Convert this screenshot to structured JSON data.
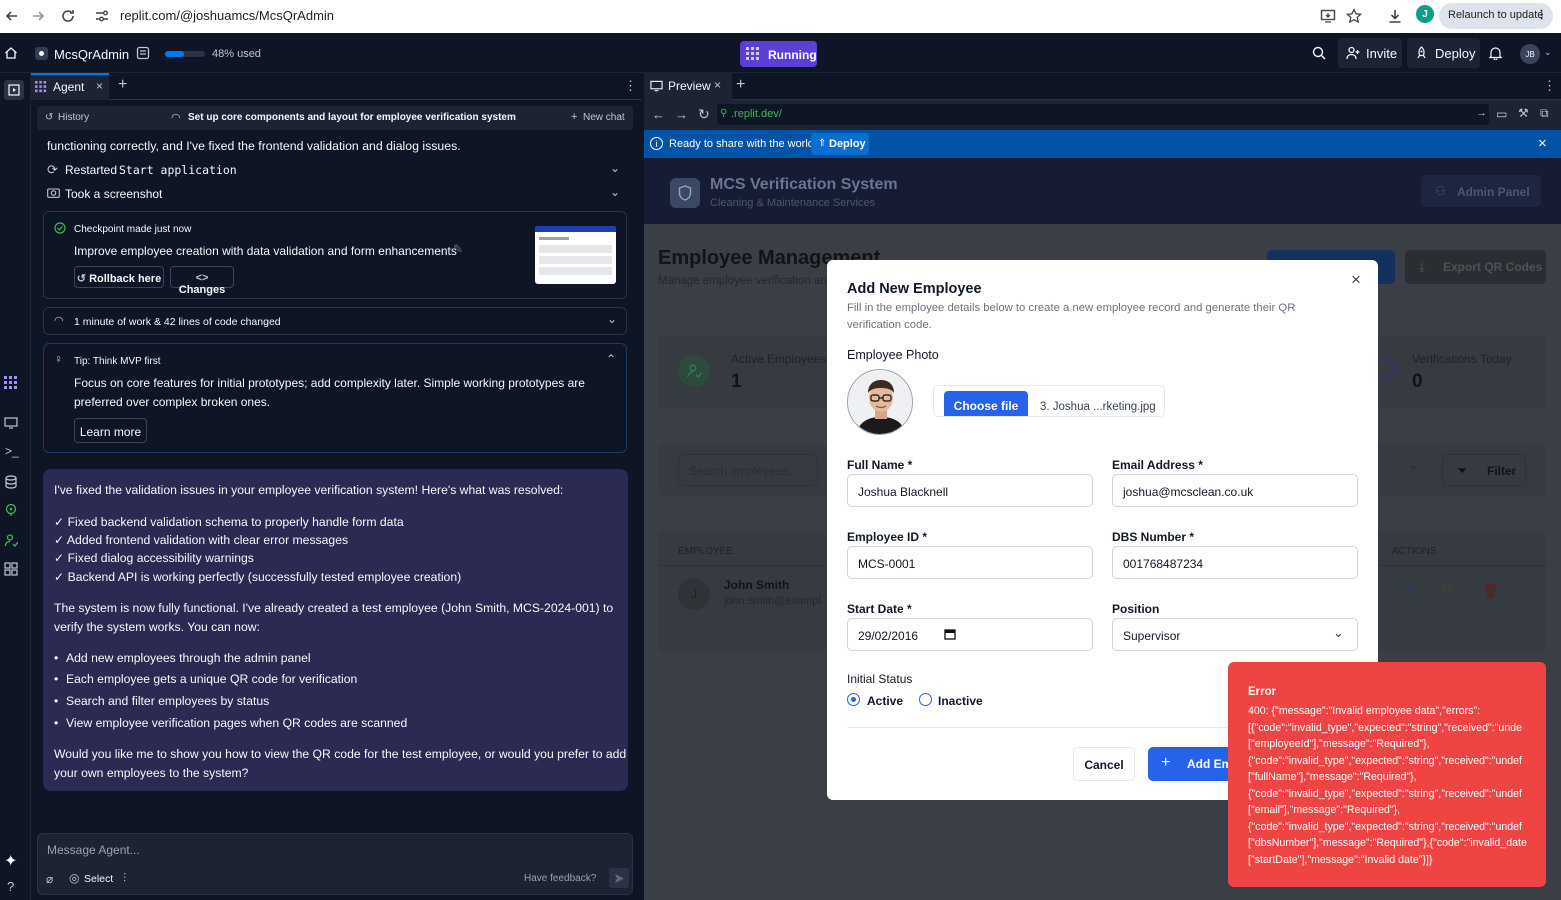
{
  "browser": {
    "url": "replit.com/@joshuamcs/McsQrAdmin",
    "profile_initial": "J",
    "relaunch_label": "Relaunch to update"
  },
  "topbar": {
    "project_name": "McsQrAdmin",
    "usage_label": "48% used",
    "usage_percent": 48,
    "running_label": "Running",
    "invite_label": "Invite",
    "deploy_label": "Deploy",
    "avatar_initials": "JB"
  },
  "agent": {
    "tab_label": "Agent",
    "history_label": "History",
    "chat_title": "Set up core components and layout for employee verification system",
    "new_chat_label": "New chat",
    "top_text": "functioning correctly, and I've fixed the frontend validation and dialog issues.",
    "restarted_prefix": "Restarted",
    "restarted_code": "Start application",
    "screenshot_label": "Took a screenshot",
    "checkpoint_header": "Checkpoint made just now",
    "checkpoint_text": "Improve employee creation with data validation and form enhancements",
    "rollback_label": "Rollback here",
    "changes_label": "Changes",
    "work_summary": "1 minute of work & 42 lines of code changed",
    "tip_title": "Tip: Think MVP first",
    "tip_line1": "Focus on core features for initial prototypes; add complexity later. Simple working prototypes are",
    "tip_line2": "preferred over complex broken ones.",
    "learn_more_label": "Learn more",
    "message": {
      "intro": "I've fixed the validation issues in your employee verification system! Here's what was resolved:",
      "checks": [
        "✓ Fixed backend validation schema to properly handle form data",
        "✓ Added frontend validation with clear error messages",
        "✓ Fixed dialog accessibility warnings",
        "✓ Backend API is working perfectly (successfully tested employee creation)"
      ],
      "status_line1": "The system is now fully functional. I've already created a test employee (John Smith, MCS-2024-001) to",
      "status_line2": "verify the system works. You can now:",
      "bullets": [
        "Add new employees through the admin panel",
        "Each employee gets a unique QR code for verification",
        "Search and filter employees by status",
        "View employee verification pages when QR codes are scanned"
      ],
      "question_line1": "Would you like me to show you how to view the QR code for the test employee, or would you prefer to add",
      "question_line2": "your own employees to the system?"
    },
    "input_placeholder": "Message Agent...",
    "select_label": "Select",
    "feedback_label": "Have feedback?"
  },
  "preview": {
    "tab_label": "Preview",
    "url": ".replit.dev/",
    "banner_text": "Ready to share with the world?",
    "banner_deploy": "Deploy",
    "app": {
      "title": "MCS Verification System",
      "subtitle": "Cleaning & Maintenance Services",
      "admin_panel": "Admin Panel",
      "page_title": "Employee Management",
      "page_subtitle": "Manage employee verification an",
      "export_label": "Export QR Codes",
      "stat_active_label": "Active Employees",
      "stat_active_value": "1",
      "stat_verif_label": "Verifications Today",
      "stat_verif_value": "0",
      "search_placeholder": "Search employees...",
      "filter_label": "Filter",
      "col_employee": "EMPLOYEE",
      "col_actions": "ACTIONS",
      "row_initial": "J",
      "row_name": "John Smith",
      "row_email": "john.smith@exampl"
    }
  },
  "modal": {
    "title": "Add New Employee",
    "desc_line1": "Fill in the employee details below to create a new employee record and generate their QR",
    "desc_line2": "verification code.",
    "photo_label": "Employee Photo",
    "choose_file": "Choose file",
    "file_name": "3. Joshua ...rketing.jpg",
    "full_name_label": "Full Name *",
    "full_name_value": "Joshua Blacknell",
    "email_label": "Email Address *",
    "email_value": "joshua@mcsclean.co.uk",
    "employee_id_label": "Employee ID *",
    "employee_id_value": "MCS-0001",
    "dbs_label": "DBS Number *",
    "dbs_value": "001768487234",
    "start_date_label": "Start Date *",
    "start_date_value": "29/02/2016",
    "position_label": "Position",
    "position_value": "Supervisor",
    "status_label": "Initial Status",
    "status_active": "Active",
    "status_inactive": "Inactive",
    "cancel_label": "Cancel",
    "add_label": "Add Em"
  },
  "toast": {
    "title": "Error",
    "lines": [
      "400: {\"message\":\"Invalid employee data\",\"errors\":",
      "[{\"code\":\"invalid_type\",\"expected\":\"string\",\"received\":\"unde",
      "[\"employeeId\"],\"message\":\"Required\"},",
      "{\"code\":\"invalid_type\",\"expected\":\"string\",\"received\":\"undef",
      "[\"fullName\"],\"message\":\"Required\"},",
      "{\"code\":\"invalid_type\",\"expected\":\"string\",\"received\":\"undef",
      "[\"email\"],\"message\":\"Required\"},",
      "{\"code\":\"invalid_type\",\"expected\":\"string\",\"received\":\"undef",
      "[\"dbsNumber\"],\"message\":\"Required\"},{\"code\":\"invalid_date",
      "[\"startDate\"],\"message\":\"Invalid date\"}]}"
    ]
  },
  "colors": {
    "accent": "#5b3fd6",
    "primary_blue": "#2563eb",
    "error_red": "#ef4444",
    "banner_blue": "#0053a6",
    "message_bg": "#2b2a53"
  }
}
